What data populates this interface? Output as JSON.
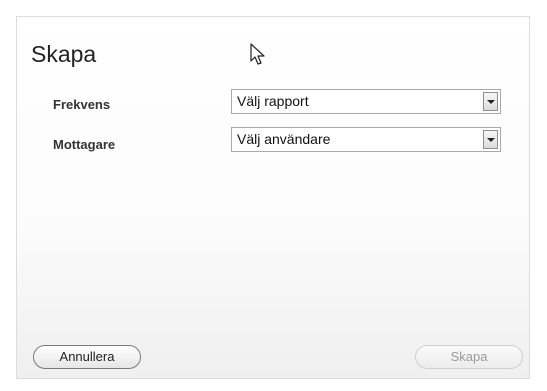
{
  "dialog": {
    "title": "Skapa"
  },
  "form": {
    "frequency": {
      "label": "Frekvens",
      "selected": "Välj rapport"
    },
    "recipient": {
      "label": "Mottagare",
      "selected": "Välj användare"
    }
  },
  "buttons": {
    "cancel_label": "Annullera",
    "create_label": "Skapa",
    "create_enabled": false
  },
  "icons": {
    "cursor": "mouse-pointer-icon",
    "dropdown": "chevron-down-icon"
  }
}
